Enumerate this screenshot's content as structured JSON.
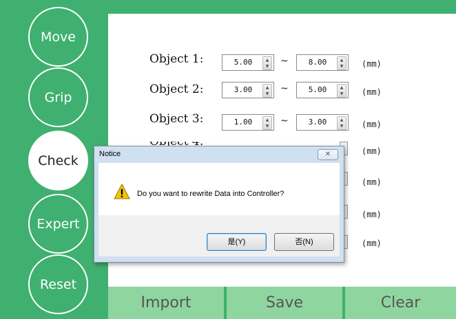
{
  "nav": {
    "move": "Move",
    "grip": "Grip",
    "check": "Check",
    "expert": "Expert",
    "reset": "Reset"
  },
  "objects": [
    {
      "label": "Object 1:",
      "min": "5.00",
      "max": "8.00",
      "unit": "(mm)"
    },
    {
      "label": "Object 2:",
      "min": "3.00",
      "max": "5.00",
      "unit": "(mm)"
    },
    {
      "label": "Object 3:",
      "min": "1.00",
      "max": "3.00",
      "unit": "(mm)"
    }
  ],
  "separator": "~",
  "hidden_units": [
    "(mm)",
    "(mm)",
    "(mm)",
    "(mm)"
  ],
  "partial_label": "Object 4:",
  "bottom": {
    "import": "Import",
    "save": "Save",
    "clear": "Clear"
  },
  "dialog": {
    "title": "Notice",
    "close": "✕",
    "message": "Do you want to rewrite Data into Controller?",
    "yes": "是(Y)",
    "no": "否(N)"
  },
  "colors": {
    "accent": "#3fb06f",
    "bottom_button": "#8fd59f"
  }
}
